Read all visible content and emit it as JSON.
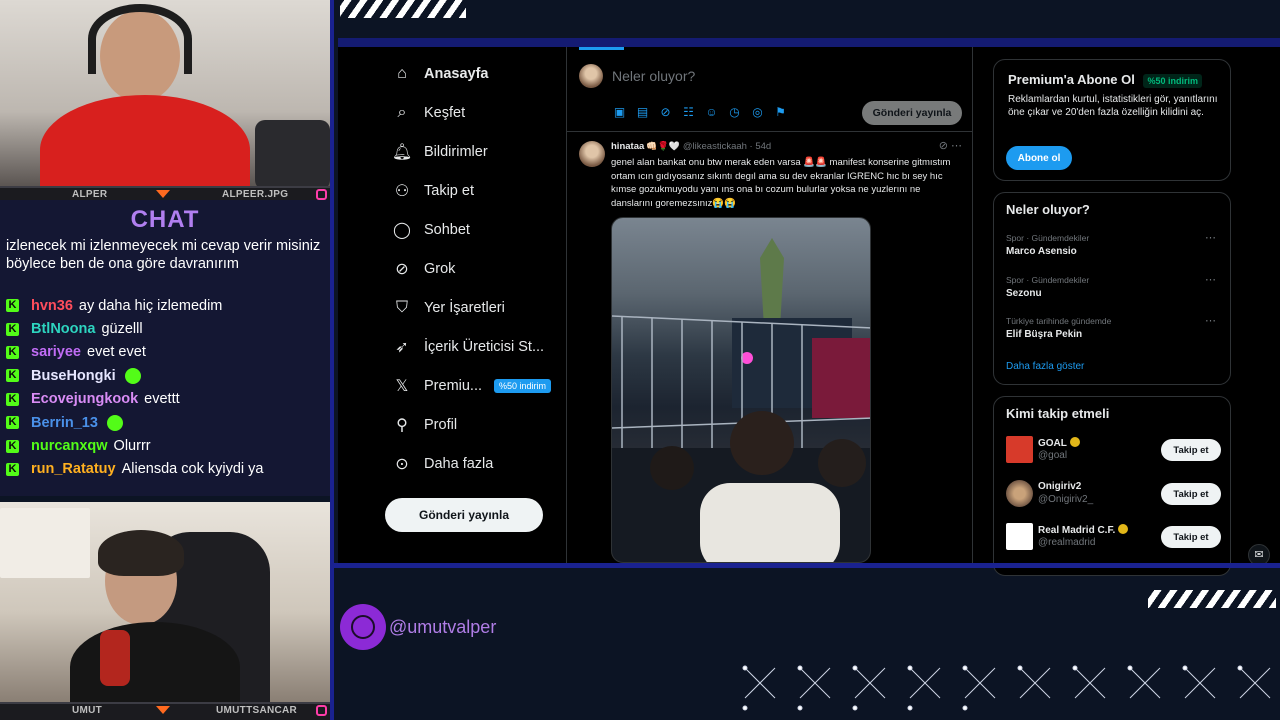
{
  "webcams": {
    "top": {
      "left_name": "ALPER",
      "right_name": "ALPEER.JPG"
    },
    "bottom": {
      "left_name": "UMUT",
      "right_name": "UMUTTSANCAR"
    }
  },
  "chat": {
    "title": "CHAT",
    "intro_text": "izlenecek mi izlenmeyecek mi cevap verir misiniz böylece ben de ona göre davranırım",
    "messages": [
      {
        "user": "hvn36",
        "text": "ay daha hiç izlemedim",
        "color": "#ff4d5c"
      },
      {
        "user": "BtlNoona",
        "text": "güzelll",
        "color": "#2dd4bf"
      },
      {
        "user": "sariyee",
        "text": "evet evet",
        "color": "#c06cf5"
      },
      {
        "user": "BuseHongki",
        "text": "",
        "color": "#e6e6ff",
        "emote": "green-blob"
      },
      {
        "user": "Ecovejungkook",
        "text": "evettt",
        "color": "#d98cf5"
      },
      {
        "user": "Berrin_13",
        "text": "",
        "color": "#4a90e8",
        "emote": "green-leaf"
      },
      {
        "user": "nurcanxqw",
        "text": "Olurrr",
        "color": "#53fc18"
      },
      {
        "user": "run_Ratatuy",
        "text": "Aliensda cok kyiydi ya",
        "color": "#ffb020"
      }
    ]
  },
  "twitter": {
    "nav": [
      {
        "label": "Anasayfa",
        "icon": "home-icon",
        "active": true
      },
      {
        "label": "Keşfet",
        "icon": "search-icon"
      },
      {
        "label": "Bildirimler",
        "icon": "bell-icon"
      },
      {
        "label": "Takip et",
        "icon": "add-user-icon"
      },
      {
        "label": "Sohbet",
        "icon": "chat-bubble-icon"
      },
      {
        "label": "Grok",
        "icon": "grok-icon"
      },
      {
        "label": "Yer İşaretleri",
        "icon": "bookmark-icon"
      },
      {
        "label": "İçerik Üreticisi St...",
        "icon": "rocket-icon"
      },
      {
        "label": "Premiu...",
        "icon": "x-logo-icon",
        "badge": "%50 indirim"
      },
      {
        "label": "Profil",
        "icon": "person-icon"
      },
      {
        "label": "Daha fazla",
        "icon": "more-circle-icon"
      }
    ],
    "post_button": "Gönderi yayınla",
    "compose": {
      "placeholder": "Neler oluyor?",
      "button": "Gönderi yayınla"
    },
    "tweet": {
      "name": "hinataa",
      "handle": "@likeastickaah · 54d",
      "text": "genel alan bankat onu btw merak eden varsa 🚨🚨 manifest konserine gitmıstım ortam ıcın gıdıyosanız sıkıntı degıl ama su dev ekranlar IGRENC hıc bı sey hıc kımse gozukmuyodu yanı ıns ona bı cozum bulurlar yoksa ne yuzlerını ne danslarını goremezsınız😭😭"
    },
    "premium": {
      "title": "Premium'a Abone Ol",
      "badge": "%50 indirim",
      "text": "Reklamlardan kurtul, istatistikleri gör, yanıtlarını öne çıkar ve 20'den fazla özelliğin kilidini aç.",
      "button": "Abone ol"
    },
    "trends": {
      "title": "Neler oluyor?",
      "items": [
        {
          "category": "Spor · Gündemdekiler",
          "name": "Marco Asensio"
        },
        {
          "category": "Spor · Gündemdekiler",
          "name": "Sezonu"
        },
        {
          "category": "Türkiye tarihinde gündemde",
          "name": "Elif Büşra Pekin"
        }
      ],
      "show_more": "Daha fazla göster"
    },
    "who_to_follow": {
      "title": "Kimi takip etmeli",
      "items": [
        {
          "name": "GOAL",
          "handle": "@goal",
          "button": "Takip et"
        },
        {
          "name": "Onigiriv2",
          "handle": "@Onigiriv2_",
          "button": "Takip et"
        },
        {
          "name": "Real Madrid C.F.",
          "handle": "@realmadrid",
          "button": "Takip et"
        }
      ]
    }
  },
  "social": {
    "handle": "@umutvalper",
    "icon": "globe-icon"
  }
}
